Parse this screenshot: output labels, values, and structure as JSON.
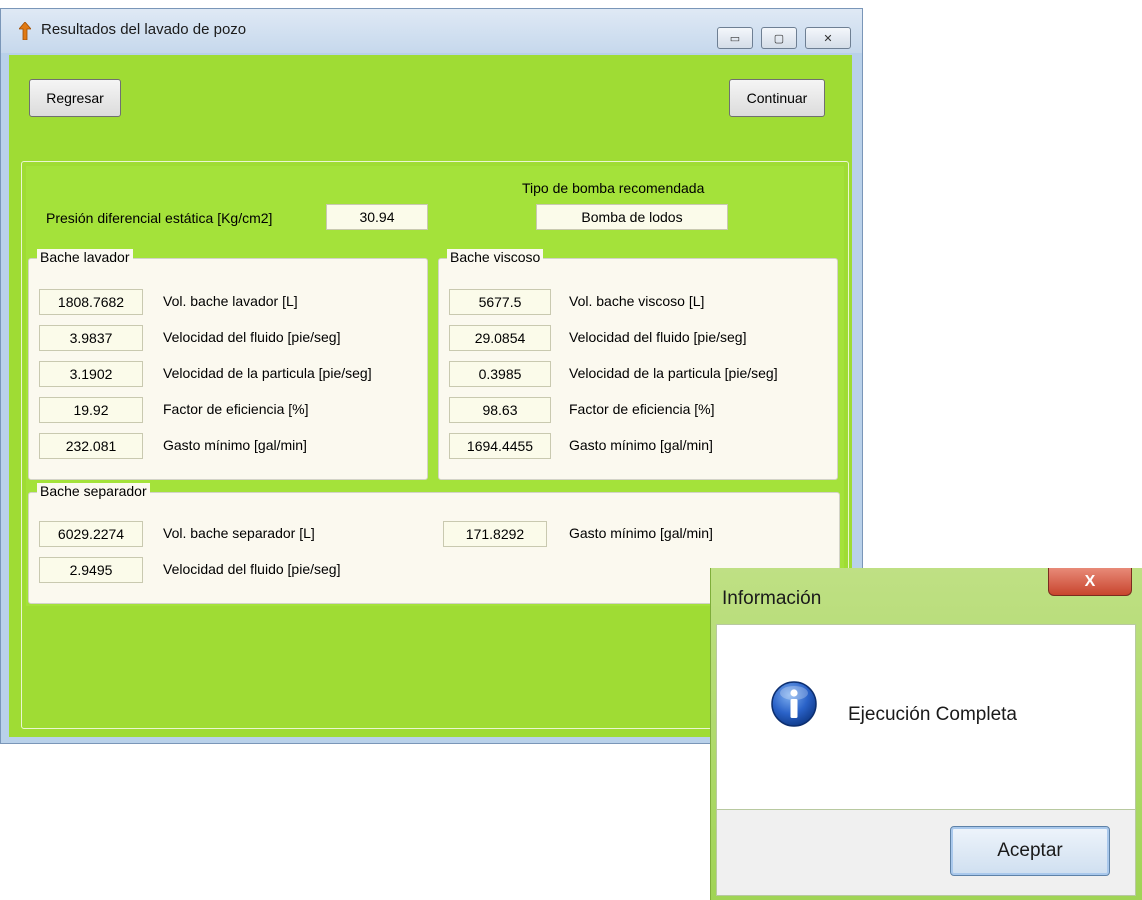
{
  "window": {
    "title": "Resultados del lavado de pozo",
    "minimize_symbol": "▭",
    "maximize_symbol": "▢",
    "close_symbol": "✕"
  },
  "toolbar": {
    "back_label": "Regresar",
    "continue_label": "Continuar"
  },
  "summary": {
    "pressure_label": "Presión diferencial estática [Kg/cm2]",
    "pressure_value": "30.94",
    "pump_label": "Tipo de bomba recomendada",
    "pump_value": "Bomba de lodos"
  },
  "bache_lavador": {
    "title": "Bache lavador",
    "rows": [
      {
        "value": "1808.7682",
        "label": "Vol. bache lavador [L]"
      },
      {
        "value": "3.9837",
        "label": "Velocidad del fluido [pie/seg]"
      },
      {
        "value": "3.1902",
        "label": "Velocidad de la particula [pie/seg]"
      },
      {
        "value": "19.92",
        "label": "Factor de eficiencia [%]"
      },
      {
        "value": "232.081",
        "label": "Gasto mínimo [gal/min]"
      }
    ]
  },
  "bache_viscoso": {
    "title": "Bache viscoso",
    "rows": [
      {
        "value": "5677.5",
        "label": "Vol. bache viscoso [L]"
      },
      {
        "value": "29.0854",
        "label": "Velocidad del fluido [pie/seg]"
      },
      {
        "value": "0.3985",
        "label": "Velocidad de la particula [pie/seg]"
      },
      {
        "value": "98.63",
        "label": "Factor de eficiencia [%]"
      },
      {
        "value": "1694.4455",
        "label": "Gasto mínimo [gal/min]"
      }
    ]
  },
  "bache_separador": {
    "title": "Bache separador",
    "vol_value": "6029.2274",
    "vol_label": "Vol. bache separador [L]",
    "gasto_value": "171.8292",
    "gasto_label": "Gasto mínimo [gal/min]",
    "vel_value": "2.9495",
    "vel_label": "Velocidad del fluido [pie/seg]"
  },
  "dialog": {
    "title": "Información",
    "close_symbol": "X",
    "message": "Ejecución Completa",
    "ok_label": "Aceptar"
  },
  "colors": {
    "client_background": "#9fdc34",
    "field_background": "#fbfbea",
    "group_background": "#fbf9ef"
  },
  "icons": {
    "app": "arrow-up-icon",
    "dialog": "info-icon"
  }
}
